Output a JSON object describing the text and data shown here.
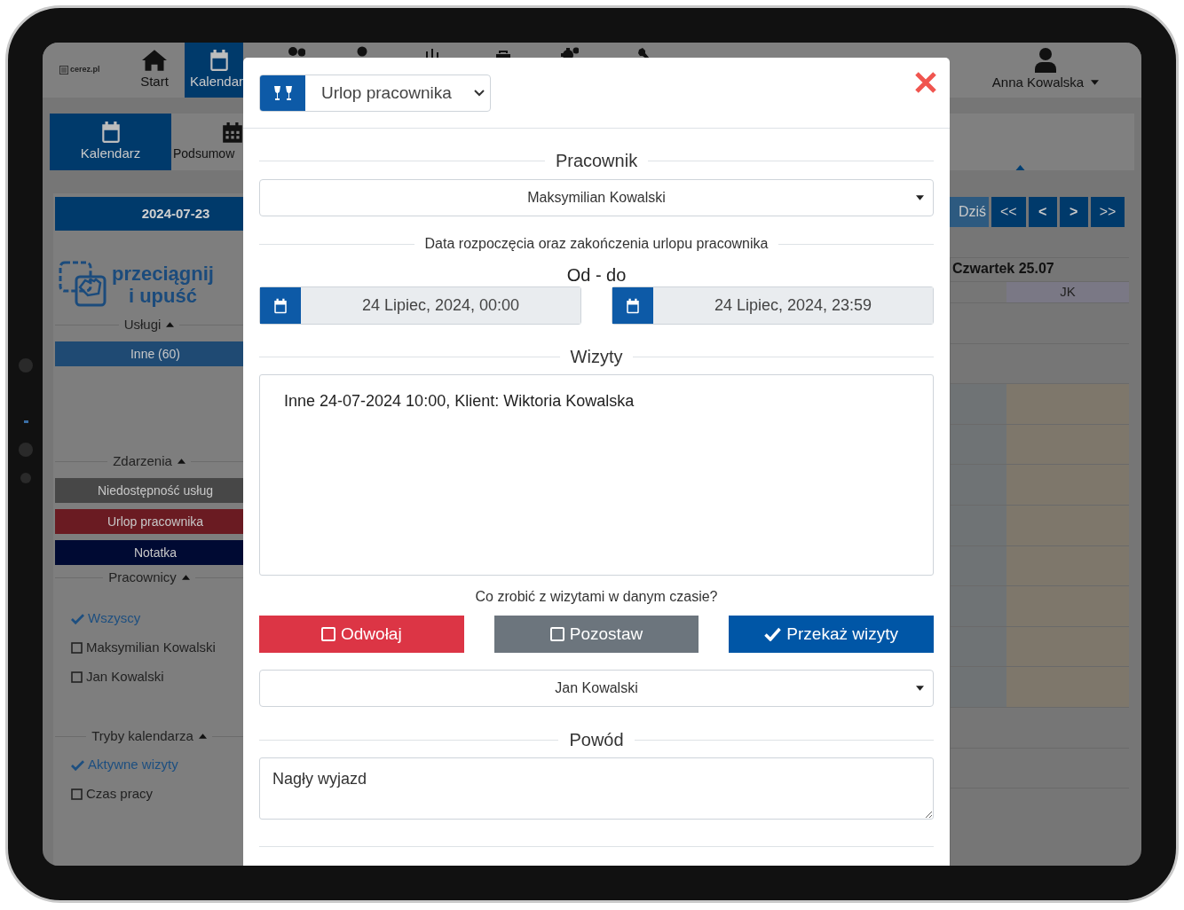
{
  "top_nav": {
    "logo": "cerez.pl",
    "tabs": [
      {
        "label": "Start",
        "selected": false
      },
      {
        "label": "Kalendar",
        "selected": true
      }
    ],
    "user": "Anna Kowalska"
  },
  "sub_nav": {
    "tabs": [
      {
        "label": "Kalendarz",
        "selected": true
      },
      {
        "label": "Podsumow",
        "selected": false
      }
    ]
  },
  "sidebar": {
    "date": "2024-07-23",
    "drag_drop": [
      "przeciągnij",
      "i upuść"
    ],
    "sections": [
      {
        "title": "Usługi",
        "expanded": true,
        "items": [
          {
            "kind": "bar",
            "label": "Inne (60)",
            "color": "#1f4a73"
          }
        ]
      },
      {
        "title": "Zdarzenia",
        "expanded": true,
        "items": [
          {
            "kind": "bar",
            "label": "Niedostępność usług",
            "color": "#474747"
          },
          {
            "kind": "bar",
            "label": "Urlop pracownika",
            "color": "#6a1b22"
          },
          {
            "kind": "bar",
            "label": "Notatka",
            "color": "#000a33"
          }
        ]
      },
      {
        "title": "Pracownicy",
        "expanded": true,
        "items": [
          {
            "kind": "check",
            "label": "Wszyscy",
            "checked": true
          },
          {
            "kind": "check",
            "label": "Maksymilian Kowalski",
            "checked": false
          },
          {
            "kind": "check",
            "label": "Jan Kowalski",
            "checked": false
          }
        ]
      },
      {
        "title": "Tryby kalendarza",
        "expanded": true,
        "items": [
          {
            "kind": "check",
            "label": "Aktywne wizyty",
            "checked": true
          },
          {
            "kind": "check",
            "label": "Czas pracy",
            "checked": false
          }
        ]
      }
    ]
  },
  "calendar": {
    "nav_buttons": [
      {
        "label": "Dziś",
        "disabled": true
      },
      {
        "label": "<<",
        "disabled": false
      },
      {
        "label": "<",
        "disabled": false
      },
      {
        "label": ">",
        "disabled": false
      },
      {
        "label": ">>",
        "disabled": false
      }
    ],
    "day": "Czwartek 25.07",
    "columns": [
      "JK"
    ]
  },
  "modal": {
    "event_type": "Urlop pracownika",
    "employee_legend": "Pracownik",
    "employee": "Maksymilian Kowalski",
    "dates_legend": "Data rozpoczęcia oraz zakończenia urlopu pracownika",
    "range_label": "Od - do",
    "date_from": "24 Lipiec, 2024, 00:00",
    "date_to": "24 Lipiec, 2024, 23:59",
    "visits_legend": "Wizyty",
    "visits": [
      "Inne 24-07-2024 10:00, Klient: Wiktoria Kowalska"
    ],
    "question": "Co zrobić z wizytami w danym czasie?",
    "actions": [
      {
        "label": "Odwołaj",
        "kind": "danger",
        "selected": false
      },
      {
        "label": "Pozostaw",
        "kind": "secondary",
        "selected": false
      },
      {
        "label": "Przekaż wizyty",
        "kind": "primary",
        "selected": true
      }
    ],
    "transfer_to": "Jan Kowalski",
    "reason_legend": "Powód",
    "reason": "Nagły wyjazd"
  }
}
